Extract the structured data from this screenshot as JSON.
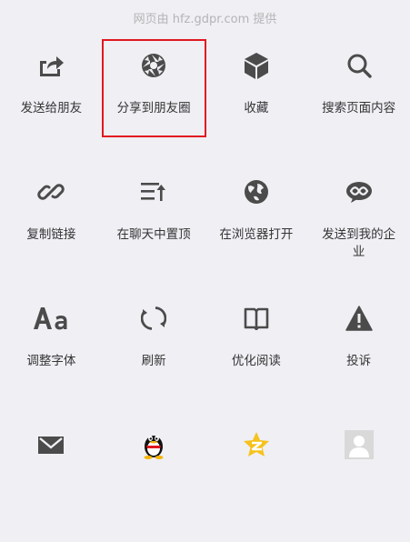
{
  "source_text": "网页由 hfz.gdpr.com 提供",
  "highlight_color": "#e0181f",
  "icon_color": "#4b4b4b",
  "rows": [
    [
      {
        "label": "发送给朋友",
        "icon": "share-arrow-icon"
      },
      {
        "label": "分享到朋友圈",
        "icon": "moments-aperture-icon",
        "highlighted": true
      },
      {
        "label": "收藏",
        "icon": "cube-icon"
      },
      {
        "label": "搜索页面内容",
        "icon": "search-icon"
      }
    ],
    [
      {
        "label": "复制链接",
        "icon": "link-icon"
      },
      {
        "label": "在聊天中置顶",
        "icon": "pin-to-top-icon"
      },
      {
        "label": "在浏览器打开",
        "icon": "globe-icon"
      },
      {
        "label": "发送到我的企业",
        "icon": "wework-icon"
      }
    ],
    [
      {
        "label": "调整字体",
        "icon": "font-size-icon"
      },
      {
        "label": "刷新",
        "icon": "refresh-icon"
      },
      {
        "label": "优化阅读",
        "icon": "book-icon"
      },
      {
        "label": "投诉",
        "icon": "warning-icon"
      }
    ],
    [
      {
        "label": "",
        "icon": "mail-icon"
      },
      {
        "label": "",
        "icon": "qq-penguin-icon"
      },
      {
        "label": "",
        "icon": "qzone-star-icon"
      },
      {
        "label": "",
        "icon": "contact-avatar-icon"
      }
    ]
  ]
}
